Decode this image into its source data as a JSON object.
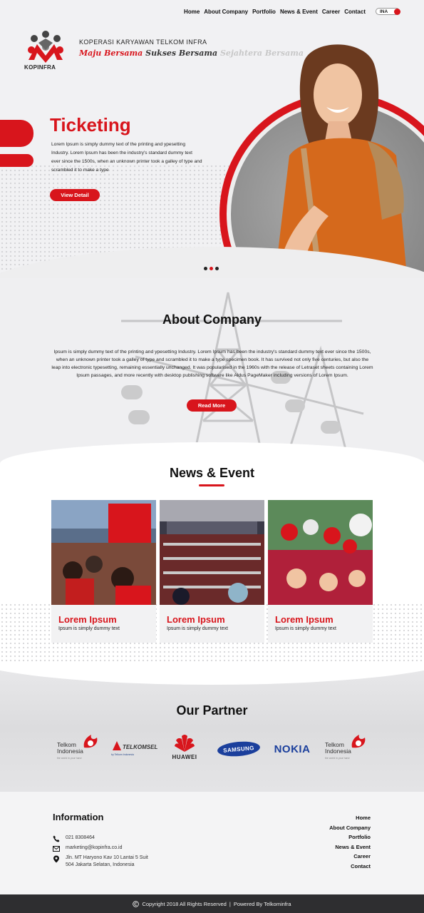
{
  "nav": {
    "items": [
      "Home",
      "About Company",
      "Portfolio",
      "News & Event",
      "Career",
      "Contact"
    ],
    "language": "INA"
  },
  "brand": {
    "logo_text": "KOPINFRA",
    "company_name": "KOPERASI KARYAWAN TELKOM INFRA",
    "tagline": [
      "Maju Bersama",
      "Sukses Bersama",
      "Sejahtera Bersama"
    ]
  },
  "hero": {
    "title": "Ticketing",
    "text": "Lorem Ipsum is simply dummy text of the printing and ypesetting Industry. Lorem Ipsum has been the industry's standard dummy text ever since the 1500s, when an unknown printer took a galley of type and scrambled it to make a type",
    "button": "View Detail",
    "slides": 3,
    "active_slide": 2
  },
  "about": {
    "title": "About Company",
    "text": "Ipsum is simply dummy text of the printing and ypesetting Industry. Lorem Ipsum has been the industry's standard dummy text ever since the 1500s, when an unknown printer took a galley of type and scrambled it to make a type specimen book. It has survived not only five centuries, but also the leap into electronic typesetting, remaining essentially unchanged. It was popularised in the 1960s with the release of Letraset sheets containing Lorem Ipsum passages, and more recently with desktop publishing software like Aldus PageMaker including versions of Lorem Ipsum.",
    "button": "Read More"
  },
  "news": {
    "title": "News & Event",
    "cards": [
      {
        "title": "Lorem Ipsum",
        "sub": "Ipsum is simply dummy text"
      },
      {
        "title": "Lorem Ipsum",
        "sub": "Ipsum is simply dummy text"
      },
      {
        "title": "Lorem Ipsum",
        "sub": "Ipsum is simply dummy text"
      }
    ]
  },
  "partner": {
    "title": "Our Partner",
    "logos": [
      {
        "name": "Telkom Indonesia",
        "line1": "Telkom",
        "line2": "Indonesia",
        "tag": "the world in your hand"
      },
      {
        "name": "Telkomsel",
        "line1": "TELKOMSEL",
        "tag": "by Telkom Indonesia"
      },
      {
        "name": "Huawei",
        "line1": "HUAWEI"
      },
      {
        "name": "Samsung",
        "line1": "SAMSUNG"
      },
      {
        "name": "Nokia",
        "line1": "NOKIA"
      },
      {
        "name": "Telkom Indonesia",
        "line1": "Telkom",
        "line2": "Indonesia",
        "tag": "the world in your hand"
      }
    ]
  },
  "footer": {
    "info_title": "Information",
    "phone": "021 8308464",
    "email": "marketing@kopinfra.co.id",
    "address_line1": "Jln. MT Haryono Kav 10 Lantai 5 Suit",
    "address_line2": "504 Jakarta Selatan, Indonesia",
    "links": [
      "Home",
      "About Company",
      "Portfolio",
      "News & Event",
      "Career",
      "Contact"
    ],
    "copyright": "Copyright 2018 All Rights Reserved",
    "separator": "|",
    "powered": "Powered By Telkominfra"
  },
  "colors": {
    "accent": "#d8151c",
    "dark": "#2e2e30",
    "bg": "#f2f2f4"
  }
}
